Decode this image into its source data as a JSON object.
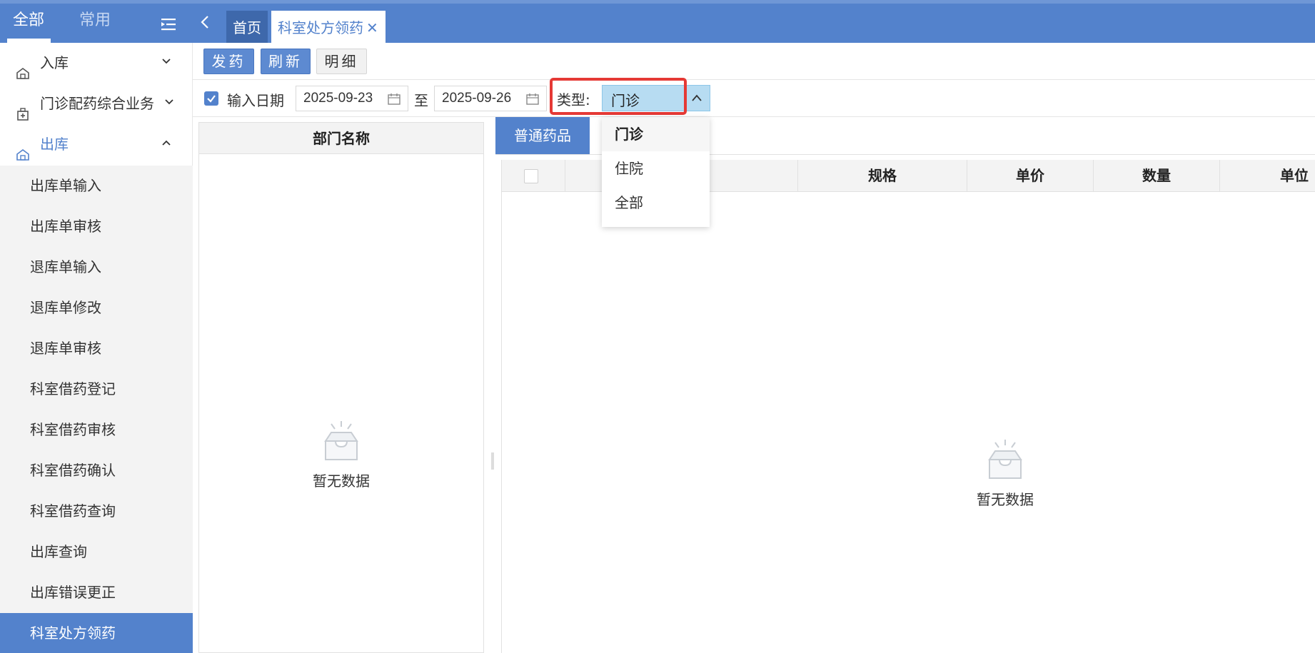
{
  "top_nav": {
    "tabs": [
      {
        "label": "全部",
        "active": true
      },
      {
        "label": "常用",
        "active": false
      }
    ],
    "page_tabs": [
      {
        "label": "首页"
      },
      {
        "label": "科室处方领药",
        "closable": true
      }
    ]
  },
  "sidebar": {
    "groups": [
      {
        "label": "入库",
        "icon": "warehouse-icon",
        "expanded": false
      },
      {
        "label": "门诊配药综合业务",
        "icon": "pharmacy-box-icon",
        "expanded": false
      },
      {
        "label": "出库",
        "icon": "warehouse-icon",
        "expanded": true
      }
    ],
    "sub_items": [
      {
        "label": "出库单输入"
      },
      {
        "label": "出库单审核"
      },
      {
        "label": "退库单输入"
      },
      {
        "label": "退库单修改"
      },
      {
        "label": "退库单审核"
      },
      {
        "label": "科室借药登记"
      },
      {
        "label": "科室借药审核"
      },
      {
        "label": "科室借药确认"
      },
      {
        "label": "科室借药查询"
      },
      {
        "label": "出库查询"
      },
      {
        "label": "出库错误更正"
      },
      {
        "label": "科室处方领药",
        "selected": true
      }
    ]
  },
  "toolbar": {
    "dispense_label": "发药",
    "refresh_label": "刷新",
    "detail_label": "明细"
  },
  "filters": {
    "date_checkbox_checked": true,
    "date_label": "输入日期",
    "start_date": "2025-09-23",
    "to_label": "至",
    "end_date": "2025-09-26",
    "type_label": "类型:",
    "type_value": "门诊",
    "type_options": [
      "门诊",
      "住院",
      "全部"
    ]
  },
  "dept_grid": {
    "header": "部门名称",
    "empty_text": "暂无数据"
  },
  "drug_grid": {
    "tab_label": "普通药品",
    "columns": [
      "",
      "规格",
      "单价",
      "数量",
      "单位"
    ],
    "empty_text": "暂无数据"
  },
  "colors": {
    "brand": "#5382cc",
    "highlight": "#e53935",
    "select_bg": "#b7dcf2"
  }
}
